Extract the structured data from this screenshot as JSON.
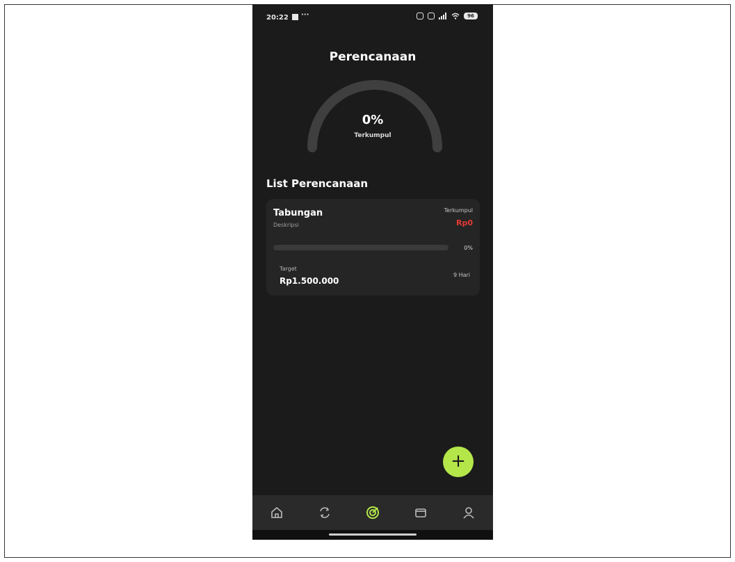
{
  "status_bar": {
    "time": "20:22",
    "dots": "···",
    "battery": "96"
  },
  "header": {
    "title": "Perencanaan"
  },
  "summary": {
    "percent": "0%",
    "label": "Terkumpul",
    "progress": 0
  },
  "list": {
    "title": "List Perencanaan",
    "items": [
      {
        "title": "Tabungan",
        "description": "Deskripsi",
        "collected_label": "Terkumpul",
        "collected_value": "Rp0",
        "progress": 0,
        "percent_label": "0%",
        "target_label": "Target",
        "target_value": "Rp1.500.000",
        "days_left": "9 Hari"
      }
    ]
  },
  "fab": {
    "label": "+"
  },
  "bottom_nav": {
    "items": [
      {
        "icon": "home-icon",
        "active": false
      },
      {
        "icon": "refresh-icon",
        "active": false
      },
      {
        "icon": "target-icon",
        "active": true
      },
      {
        "icon": "wallet-icon",
        "active": false
      },
      {
        "icon": "user-icon",
        "active": false
      }
    ]
  },
  "colors": {
    "accent": "#b4e64a",
    "danger": "#e53935",
    "background": "#1b1b1b",
    "card": "#252525"
  }
}
